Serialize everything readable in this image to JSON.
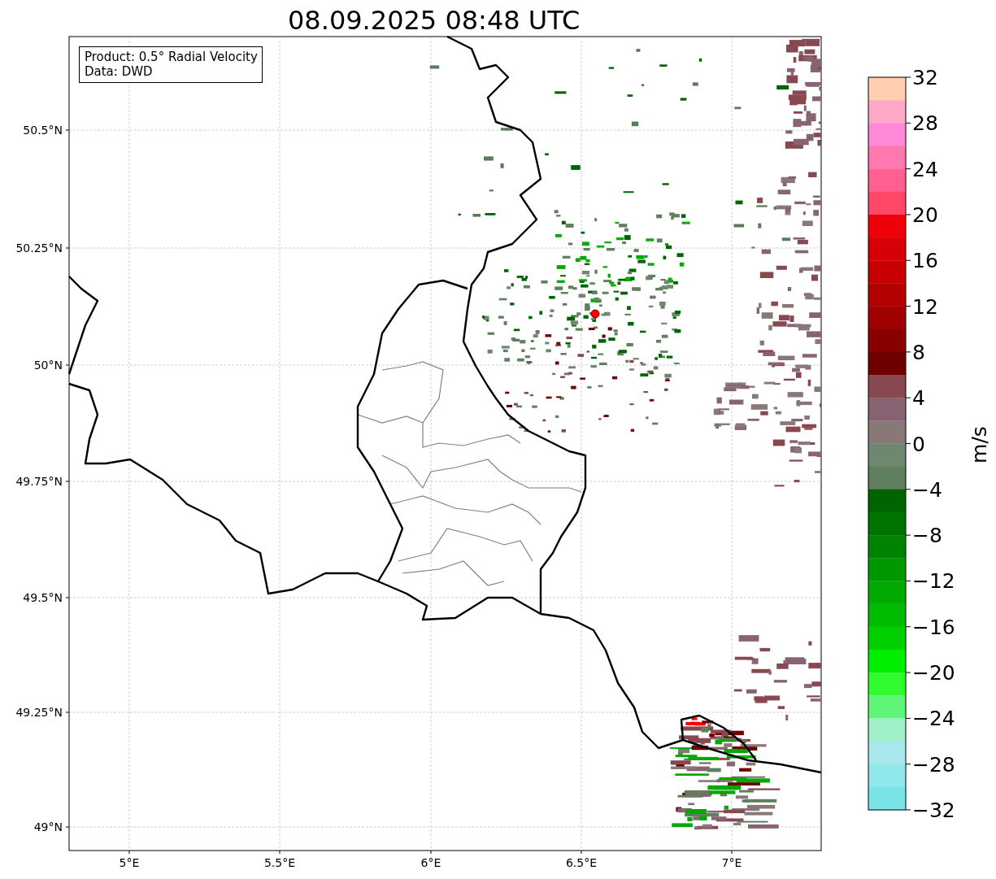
{
  "title": "08.09.2025 08:48 UTC",
  "info_box": {
    "lines": [
      "Product: 0.5° Radial Velocity",
      "Data: DWD"
    ]
  },
  "map": {
    "x_ticks": [
      "5°E",
      "5.5°E",
      "6°E",
      "6.5°E",
      "7°E"
    ],
    "y_ticks": [
      "50.5°N",
      "50.25°N",
      "50°N",
      "49.75°N",
      "49.5°N",
      "49.25°N",
      "49°N"
    ]
  },
  "colorbar": {
    "label": "m/s",
    "ticks": [
      "32",
      "28",
      "24",
      "20",
      "16",
      "12",
      "8",
      "4",
      "0",
      "−4",
      "−8",
      "−12",
      "−16",
      "−20",
      "−24",
      "−28",
      "−32"
    ],
    "bins": [
      {
        "color": "#ffcfb0"
      },
      {
        "color": "#ffa8c8"
      },
      {
        "color": "#ff88d8"
      },
      {
        "color": "#ff78b0"
      },
      {
        "color": "#ff6090"
      },
      {
        "color": "#ff4868"
      },
      {
        "color": "#f00008"
      },
      {
        "color": "#d80008"
      },
      {
        "color": "#c80004"
      },
      {
        "color": "#b40000"
      },
      {
        "color": "#a00000"
      },
      {
        "color": "#880000"
      },
      {
        "color": "#6e0000"
      },
      {
        "color": "#884850"
      },
      {
        "color": "#886472"
      },
      {
        "color": "#887878"
      },
      {
        "color": "#6f876f"
      },
      {
        "color": "#5f7f5f"
      },
      {
        "color": "#006400"
      },
      {
        "color": "#007400"
      },
      {
        "color": "#008400"
      },
      {
        "color": "#009800"
      },
      {
        "color": "#00aa00"
      },
      {
        "color": "#00bc00"
      },
      {
        "color": "#00d000"
      },
      {
        "color": "#00ee00"
      },
      {
        "color": "#30fc30"
      },
      {
        "color": "#60f478"
      },
      {
        "color": "#a0f0c8"
      },
      {
        "color": "#a8e8ec"
      },
      {
        "color": "#90e8ec"
      },
      {
        "color": "#78e4e8"
      }
    ]
  }
}
